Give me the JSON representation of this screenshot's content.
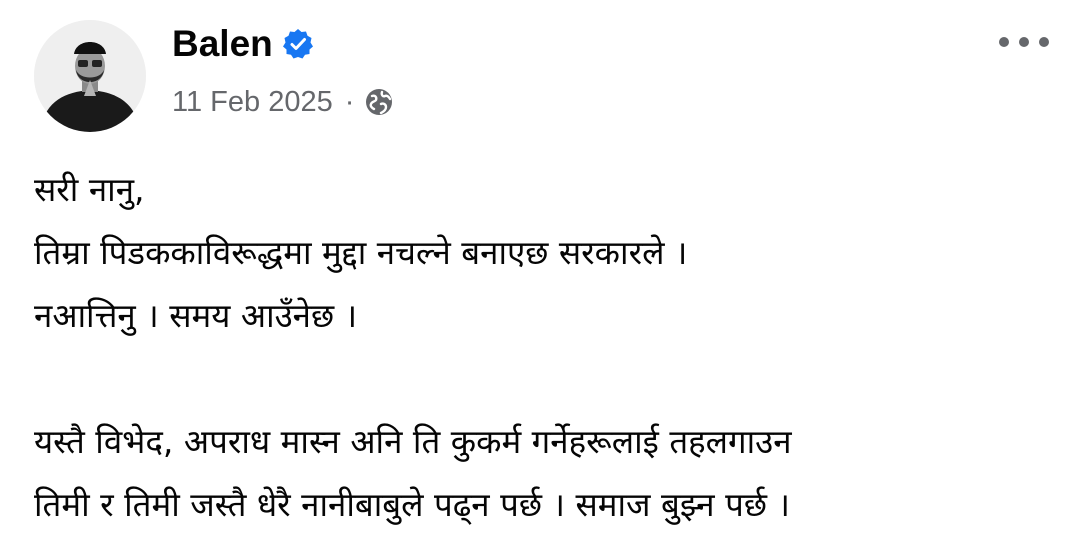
{
  "post": {
    "author": "Balen",
    "verified": true,
    "date": "11 Feb 2025",
    "separator": "·",
    "audience_icon": "globe-icon",
    "more_icon": "more-options-icon",
    "lines": [
      "सरी नानु,",
      "तिम्रा पिडककाविरूद्धमा मुद्दा नचल्ने बनाएछ सरकारले ।",
      "नआत्तिनु । समय आउँनेछ ।",
      "",
      "यस्तै विभेद, अपराध मास्न अनि ति कुकर्म गर्नेहरूलाई तहलगाउन",
      "तिमी र तिमी जस्तै धेरै नानीबाबुले पढ्न पर्छ । समाज बुझ्न पर्छ ।"
    ]
  },
  "colors": {
    "verified_badge": "#1877f2",
    "meta_text": "#65676b",
    "text": "#050505"
  }
}
